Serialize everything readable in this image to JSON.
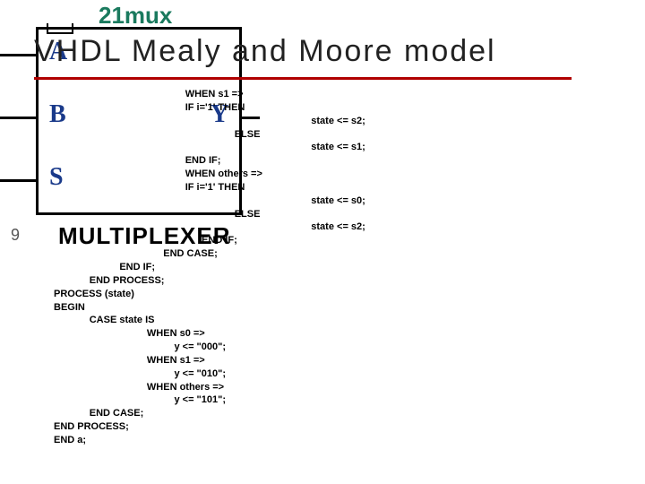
{
  "diagram": {
    "title": "21mux",
    "ports": {
      "a": "A",
      "b": "B",
      "s": "S",
      "y": "Y"
    },
    "name": "MULTIPLEXER",
    "corner_num": "9"
  },
  "slide": {
    "title": "VHDL Mealy and Moore model"
  },
  "code": {
    "l01": "                                                WHEN s1 =>",
    "l02": "                                                IF i='1' THEN",
    "l03": "                                                                                              state <= s2;",
    "l04": "                                                                  ELSE",
    "l05": "                                                                                              state <= s1;",
    "l06": "                                                END IF;",
    "l07": "                                                WHEN others =>",
    "l08": "                                                IF i='1' THEN",
    "l09": "                                                                                              state <= s0;",
    "l10": "                                                                  ELSE",
    "l11": "                                                                                              state <= s2;",
    "l12": "                                                      END IF;",
    "l13": "                                        END CASE;",
    "l14": "                        END IF;",
    "l15": "             END PROCESS;",
    "l16": "PROCESS (state)",
    "l17": "BEGIN",
    "l18": "             CASE state IS",
    "l19": "                                  WHEN s0 =>",
    "l20": "                                            y <= \"000\";",
    "l21": "                                  WHEN s1 =>",
    "l22": "                                            y <= \"010\";",
    "l23": "                                  WHEN others =>",
    "l24": "                                            y <= \"101\";",
    "l25": "             END CASE;",
    "l26": "END PROCESS;",
    "l27": "END a;"
  }
}
